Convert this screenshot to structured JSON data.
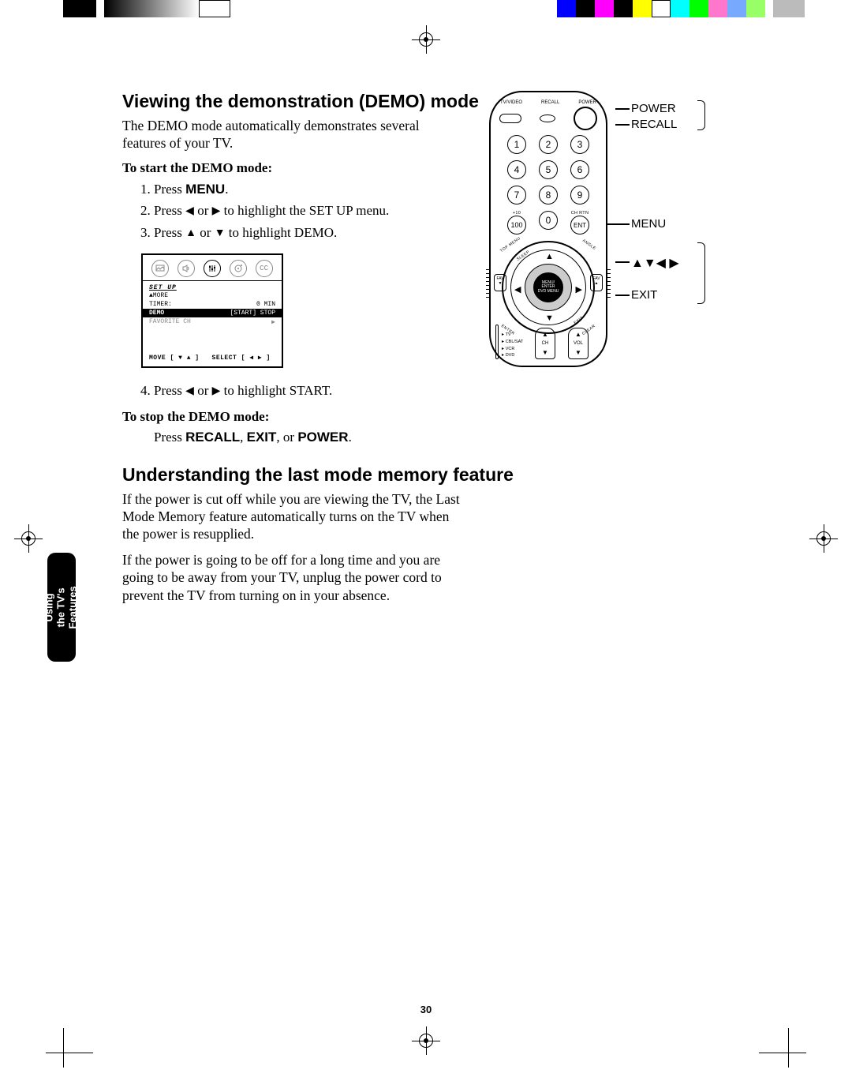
{
  "page_number": "30",
  "chapter_tab": "Using the TV's\nFeatures",
  "section1": {
    "heading": "Viewing the demonstration (DEMO) mode",
    "intro": "The DEMO mode automatically demonstrates several features of your TV.",
    "start_heading": "To start the DEMO mode:",
    "steps_pre": [
      "Press ",
      "Press ",
      "Press "
    ],
    "menu_word": "MENU",
    "step2_mid_a": " or ",
    "step2_tail": " to highlight the SET UP menu.",
    "step3_mid_a": " or ",
    "step3_tail": " to highlight DEMO.",
    "step4_pre": "Press ",
    "step4_mid_a": " or ",
    "step4_tail": " to highlight START.",
    "stop_heading": "To stop the DEMO mode:",
    "stop_line_pre": "Press  ",
    "stop_recall": "RECALL",
    "stop_sep1": ", ",
    "stop_exit": "EXIT",
    "stop_sep2": ", or ",
    "stop_power": "POWER",
    "stop_tail": "."
  },
  "osd": {
    "title": "SET UP",
    "rows": [
      {
        "l": "▲MORE",
        "r": ""
      },
      {
        "l": "TIMER:",
        "r": "0 MIN"
      }
    ],
    "hl": {
      "l": "DEMO",
      "r": "[START]  STOP"
    },
    "rows2": [
      {
        "l": "FAVORITE CH",
        "r": "▶"
      }
    ],
    "foot_move": "MOVE [ ▼ ▲ ]",
    "foot_select": "SELECT [ ◀  ▶ ]",
    "icon_cc": "CC"
  },
  "section2": {
    "heading": "Understanding the last mode memory feature",
    "p1": "If the power is cut off while you are viewing the TV, the Last Mode Memory feature automatically turns on the TV when the power is resupplied.",
    "p2": "If the power is going to be off for a long time and you are going to be away from your TV, unplug the power cord to prevent the TV from turning on in your absence."
  },
  "remote": {
    "top": {
      "tvvideo": "TV/VIDEO",
      "recall": "RECALL",
      "power": "POWER"
    },
    "num": [
      "1",
      "2",
      "3",
      "4",
      "5",
      "6",
      "7",
      "8",
      "9",
      "100",
      "0",
      "ENT"
    ],
    "plus10": "+10",
    "chrtn": "CH RTN",
    "nav_center": "MENU/\nENTER\nDVD MENU",
    "corners": {
      "tl": "TOP MENU",
      "tr": "ANGLE",
      "bl": "ENTER",
      "br": "CLEAR",
      "sleep": "SLEEP",
      "exit": "EXIT"
    },
    "fav_l": "FAV\n▼",
    "fav_r": "FAV\n▲",
    "rocker_ch": "CH",
    "rocker_vol": "VOL",
    "modes": [
      "TV",
      "CBL/SAT",
      "VCR",
      "DVD"
    ]
  },
  "callouts": {
    "power": "POWER",
    "recall": "RECALL",
    "menu": "MENU",
    "arrows": "▲▼◀ ▶",
    "exit": "EXIT"
  },
  "glyphs": {
    "left": "◀",
    "right": "▶",
    "up": "▲",
    "down": "▼"
  }
}
